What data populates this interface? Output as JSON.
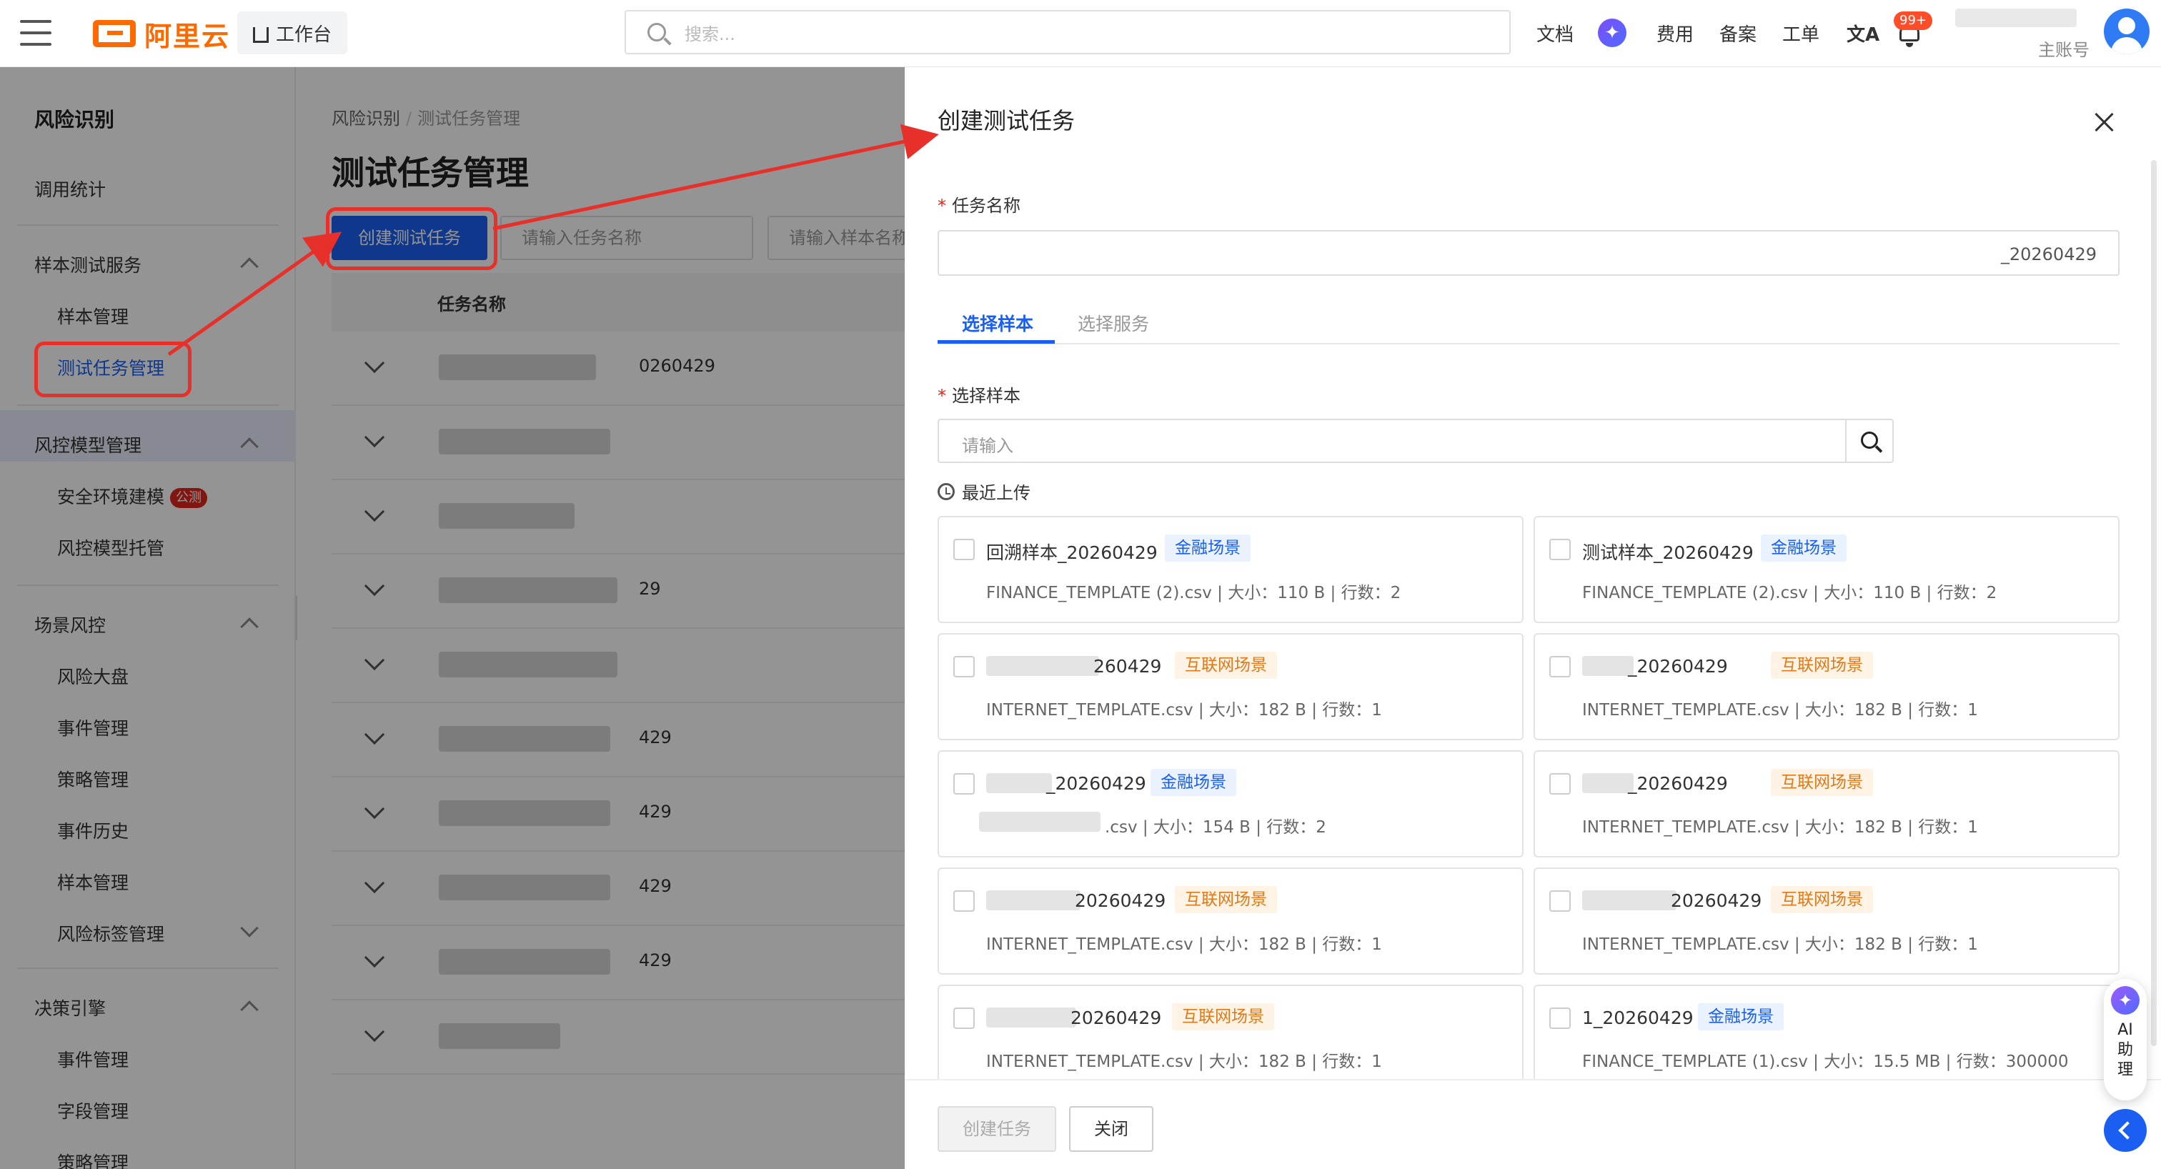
{
  "topbar": {
    "logo_text": "阿里云",
    "workbench": "工作台",
    "search_placeholder": "搜索...",
    "links": [
      "文档",
      "费用",
      "备案",
      "工单"
    ],
    "badge": "99+",
    "account_label": "主账号"
  },
  "sidebar": {
    "title": "风险识别",
    "items": [
      {
        "label": "调用统计"
      },
      {
        "label": "样本测试服务",
        "expanded": true
      },
      {
        "label": "样本管理"
      },
      {
        "label": "测试任务管理",
        "active": true
      },
      {
        "label": "风控模型管理",
        "expanded": true
      },
      {
        "label": "安全环境建模",
        "tag": "公测"
      },
      {
        "label": "风控模型托管"
      },
      {
        "label": "场景风控",
        "expanded": true
      },
      {
        "label": "风险大盘"
      },
      {
        "label": "事件管理"
      },
      {
        "label": "策略管理"
      },
      {
        "label": "事件历史"
      },
      {
        "label": "样本管理"
      },
      {
        "label": "风险标签管理"
      },
      {
        "label": "决策引擎",
        "expanded": true
      },
      {
        "label": "事件管理"
      },
      {
        "label": "字段管理"
      },
      {
        "label": "策略管理"
      }
    ]
  },
  "main": {
    "breadcrumb": [
      "风险识别",
      "测试任务管理"
    ],
    "title": "测试任务管理",
    "create_button": "创建测试任务",
    "filter_task_placeholder": "请输入任务名称",
    "filter_sample_placeholder": "请输入样本名称",
    "table_header": "任务名称",
    "rows": [
      "0260429",
      "",
      "",
      "29",
      "",
      "429",
      "429",
      "429",
      "429",
      ""
    ]
  },
  "drawer": {
    "title": "创建测试任务",
    "task_name_label": "任务名称",
    "task_name_value": "_20260429",
    "tabs": [
      "选择样本",
      "选择服务"
    ],
    "sample_label": "选择样本",
    "sample_placeholder": "请输入",
    "recent_label": "最近上传",
    "cards": [
      {
        "name": "回溯样本_20260429",
        "tag": "金融场景",
        "tag_type": "fin",
        "meta": "FINANCE_TEMPLATE (2).csv | 大小：110 B | 行数：2"
      },
      {
        "name": "测试样本_20260429",
        "tag": "金融场景",
        "tag_type": "fin",
        "meta": "FINANCE_TEMPLATE (2).csv | 大小：110 B | 行数：2"
      },
      {
        "name": "260429",
        "tag": "互联网场景",
        "tag_type": "int",
        "meta": "INTERNET_TEMPLATE.csv | 大小：182 B | 行数：1"
      },
      {
        "name": "_20260429",
        "tag": "互联网场景",
        "tag_type": "int",
        "meta": "INTERNET_TEMPLATE.csv | 大小：182 B | 行数：1"
      },
      {
        "name": "_20260429",
        "tag": "金融场景",
        "tag_type": "fin",
        "meta": ".csv | 大小：154 B | 行数：2"
      },
      {
        "name": "_20260429",
        "tag": "互联网场景",
        "tag_type": "int",
        "meta": "INTERNET_TEMPLATE.csv | 大小：182 B | 行数：1"
      },
      {
        "name": "20260429",
        "tag": "互联网场景",
        "tag_type": "int",
        "meta": "INTERNET_TEMPLATE.csv | 大小：182 B | 行数：1"
      },
      {
        "name": "20260429",
        "tag": "互联网场景",
        "tag_type": "int",
        "meta": "INTERNET_TEMPLATE.csv | 大小：182 B | 行数：1"
      },
      {
        "name": "20260429",
        "tag": "互联网场景",
        "tag_type": "int",
        "meta": "INTERNET_TEMPLATE.csv | 大小：182 B | 行数：1"
      },
      {
        "name": "1_20260429",
        "tag": "金融场景",
        "tag_type": "fin",
        "meta": "FINANCE_TEMPLATE (1).csv | 大小：15.5 MB | 行数：300000"
      }
    ],
    "create_button": "创建任务",
    "close_button": "关闭"
  },
  "float": {
    "ai_label": "AI助理"
  },
  "colors": {
    "brand": "#ff6a00",
    "primary": "#1a5ff2",
    "annotation": "#e8302a"
  }
}
